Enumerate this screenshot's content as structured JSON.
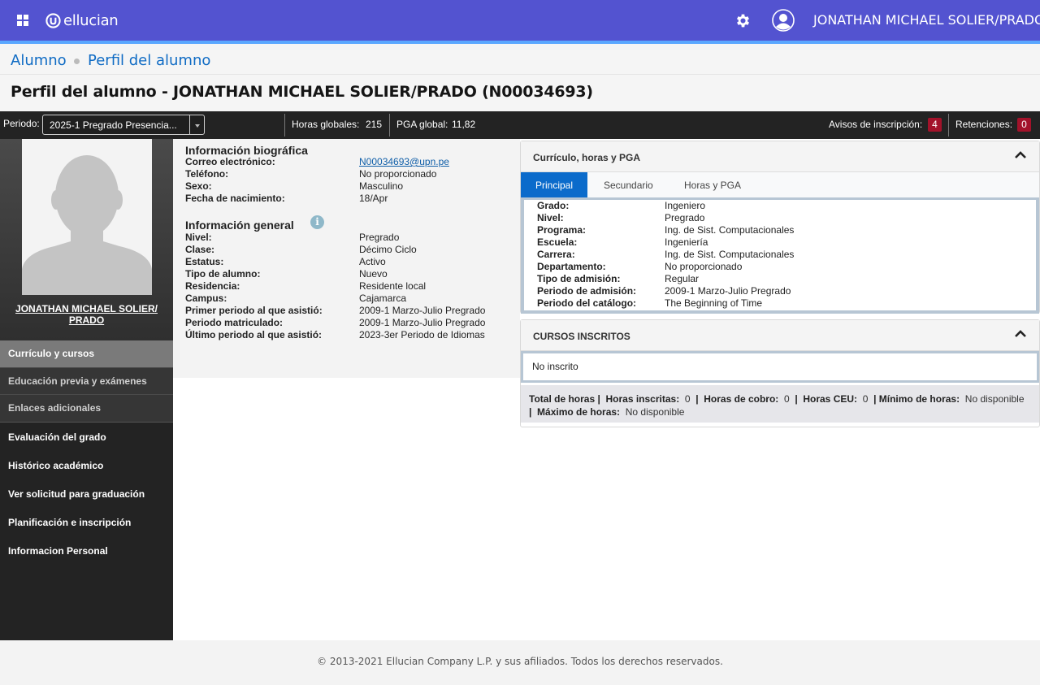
{
  "header": {
    "brand": "ellucian",
    "username": "JONATHAN MICHAEL SOLIER/PRADO"
  },
  "breadcrumb": [
    "Alumno",
    "Perfil del alumno"
  ],
  "page_title": "Perfil del alumno - JONATHAN MICHAEL SOLIER/PRADO (N00034693)",
  "infobar": {
    "period_label": "Periodo:",
    "period_value": "2025-1 Pregrado Presencia...",
    "global_hours_label": "Horas globales:",
    "global_hours_value": "215",
    "gpa_label": "PGA global:",
    "gpa_value": "11,82",
    "enrollment_alerts_label": "Avisos de inscripción:",
    "enrollment_alerts_count": "4",
    "holds_label": "Retenciones:",
    "holds_count": "0"
  },
  "sidebar": {
    "student_name": "JONATHAN MICHAEL SOLIER/ PRADO",
    "items": [
      "Currículo y cursos",
      "Educación previa y exámenes",
      "Enlaces adicionales",
      "Evaluación del grado",
      "Histórico académico",
      "Ver solicitud para graduación",
      "Planificación e inscripción",
      "Informacion Personal"
    ]
  },
  "bio": {
    "title": "Información biográfica",
    "rows": [
      {
        "label": "Correo electrónico:",
        "value": "N00034693@upn.pe"
      },
      {
        "label": "Teléfono:",
        "value": "No proporcionado"
      },
      {
        "label": "Sexo:",
        "value": "Masculino"
      },
      {
        "label": "Fecha de nacimiento:",
        "value": "18/Apr"
      }
    ]
  },
  "general": {
    "title": "Información general",
    "info_icon": "i",
    "rows": [
      {
        "label": "Nivel:",
        "value": "Pregrado"
      },
      {
        "label": "Clase:",
        "value": "Décimo Ciclo"
      },
      {
        "label": "Estatus:",
        "value": "Activo"
      },
      {
        "label": "Tipo de alumno:",
        "value": "Nuevo"
      },
      {
        "label": "Residencia:",
        "value": "Residente local"
      },
      {
        "label": "Campus:",
        "value": "Cajamarca"
      },
      {
        "label": "Primer periodo al que asistió:",
        "value": "2009-1 Marzo-Julio Pregrado"
      },
      {
        "label": "Periodo matriculado:",
        "value": "2009-1 Marzo-Julio Pregrado"
      },
      {
        "label": "Último periodo al que asistió:",
        "value": "2023-3er Periodo de Idiomas"
      }
    ]
  },
  "curriculum": {
    "title": "Currículo, horas y PGA",
    "tabs": [
      "Principal",
      "Secundario",
      "Horas y PGA"
    ],
    "rows": [
      {
        "label": "Grado:",
        "value": "Ingeniero"
      },
      {
        "label": "Nivel:",
        "value": "Pregrado"
      },
      {
        "label": "Programa:",
        "value": "Ing. de Sist. Computacionales"
      },
      {
        "label": "Escuela:",
        "value": "Ingeniería"
      },
      {
        "label": "Carrera:",
        "value": "Ing. de Sist. Computacionales"
      },
      {
        "label": "Departamento:",
        "value": "No proporcionado"
      },
      {
        "label": "Tipo de admisión:",
        "value": "Regular"
      },
      {
        "label": "Periodo de admisión:",
        "value": "2009-1 Marzo-Julio Pregrado"
      },
      {
        "label": "Periodo del catálogo:",
        "value": "The Beginning of Time"
      }
    ]
  },
  "courses": {
    "title": "CURSOS INSCRITOS",
    "empty_text": "No inscrito",
    "total_label": "Total de horas |",
    "enrolled_label": "Horas inscritas:",
    "enrolled_value": "0",
    "billing_label": "Horas de cobro:",
    "billing_value": "0",
    "ceu_label": "Horas CEU:",
    "ceu_value": "0",
    "min_label": "Mínimo de horas:",
    "min_value": "No disponible",
    "max_label": "Máximo de horas:",
    "max_value": "No disponible",
    "sep": "|"
  },
  "footer": "© 2013-2021 Ellucian Company L.P. y sus afiliados. Todos los derechos reservados.",
  "colors": {
    "topbar": "#5353d0",
    "accent_line": "#5aa7ff",
    "link": "#0f6bc4",
    "active_tab": "#0b6bcb",
    "badge": "#a3122a"
  }
}
